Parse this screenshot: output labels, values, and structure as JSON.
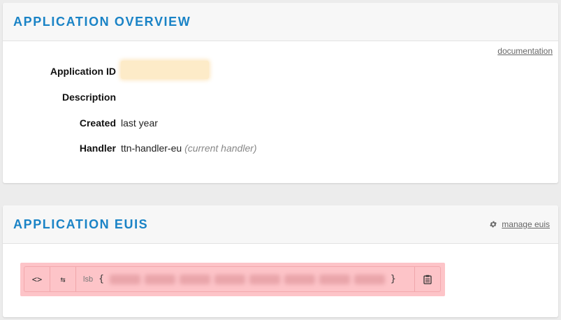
{
  "overview": {
    "title": "APPLICATION OVERVIEW",
    "documentation_link": "documentation",
    "fields": {
      "application_id": {
        "label": "Application ID",
        "value": ""
      },
      "description": {
        "label": "Description",
        "value": ""
      },
      "created": {
        "label": "Created",
        "value": "last year"
      },
      "handler": {
        "label": "Handler",
        "value": "ttn-handler-eu",
        "note": "(current handler)"
      }
    }
  },
  "euis": {
    "title": "APPLICATION EUIS",
    "manage_link": "manage euis",
    "eui": {
      "format_toggle_label": "<>",
      "swap_label": "⇆",
      "byte_order": "lsb",
      "open_brace": "{",
      "close_brace": "}",
      "bytes": [
        "",
        "",
        "",
        "",
        "",
        "",
        "",
        ""
      ]
    }
  },
  "colors": {
    "accent": "#1a83c6",
    "eui_highlight": "#fdc4c8",
    "app_id_highlight": "#fdebc8"
  },
  "icons": {
    "manage": "gear-icon",
    "copy": "clipboard-icon",
    "format": "code-brackets-icon",
    "swap": "swap-arrows-icon"
  }
}
